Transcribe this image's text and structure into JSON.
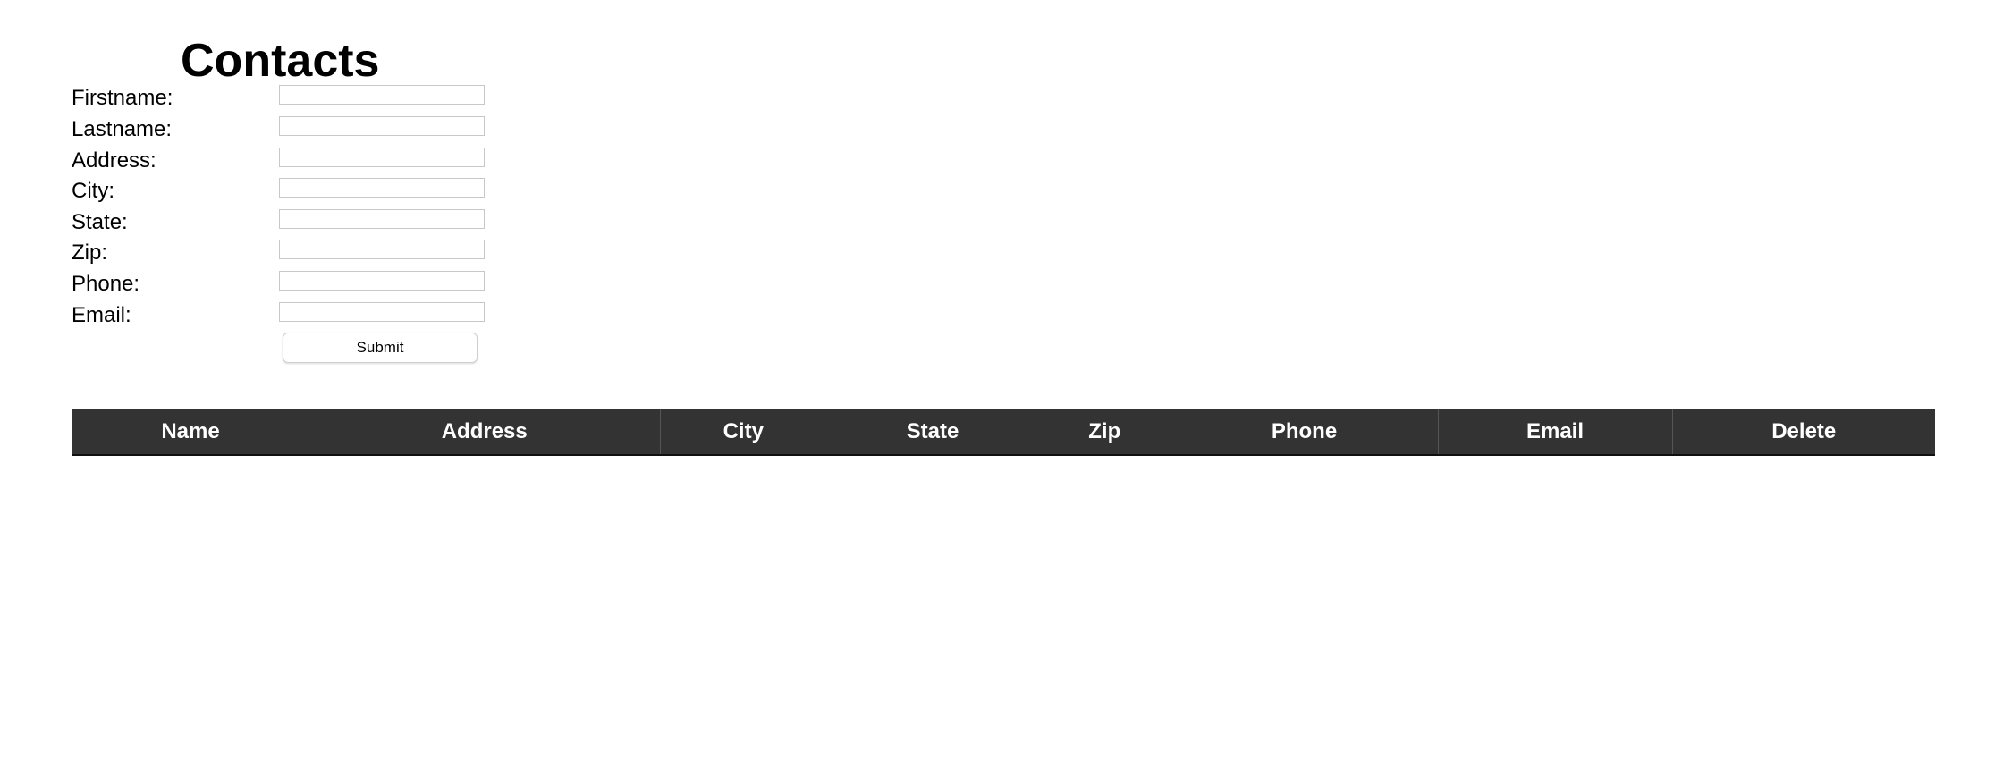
{
  "page": {
    "title": "Contacts"
  },
  "form": {
    "fields": [
      {
        "label": "Firstname:",
        "value": "",
        "placeholder": ""
      },
      {
        "label": "Lastname:",
        "value": "",
        "placeholder": ""
      },
      {
        "label": "Address:",
        "value": "",
        "placeholder": ""
      },
      {
        "label": "City:",
        "value": "",
        "placeholder": ""
      },
      {
        "label": "State:",
        "value": "",
        "placeholder": ""
      },
      {
        "label": "Zip:",
        "value": "",
        "placeholder": ""
      },
      {
        "label": "Phone:",
        "value": "",
        "placeholder": ""
      },
      {
        "label": "Email:",
        "value": "",
        "placeholder": ""
      }
    ],
    "submit_label": "Submit"
  },
  "table": {
    "headers": [
      "Name",
      "Address",
      "City",
      "State",
      "Zip",
      "Phone",
      "Email",
      "Delete"
    ],
    "rows": []
  },
  "colors": {
    "table_header_bg": "#333333",
    "table_header_text": "#ffffff",
    "input_border": "#c8c8c8"
  }
}
